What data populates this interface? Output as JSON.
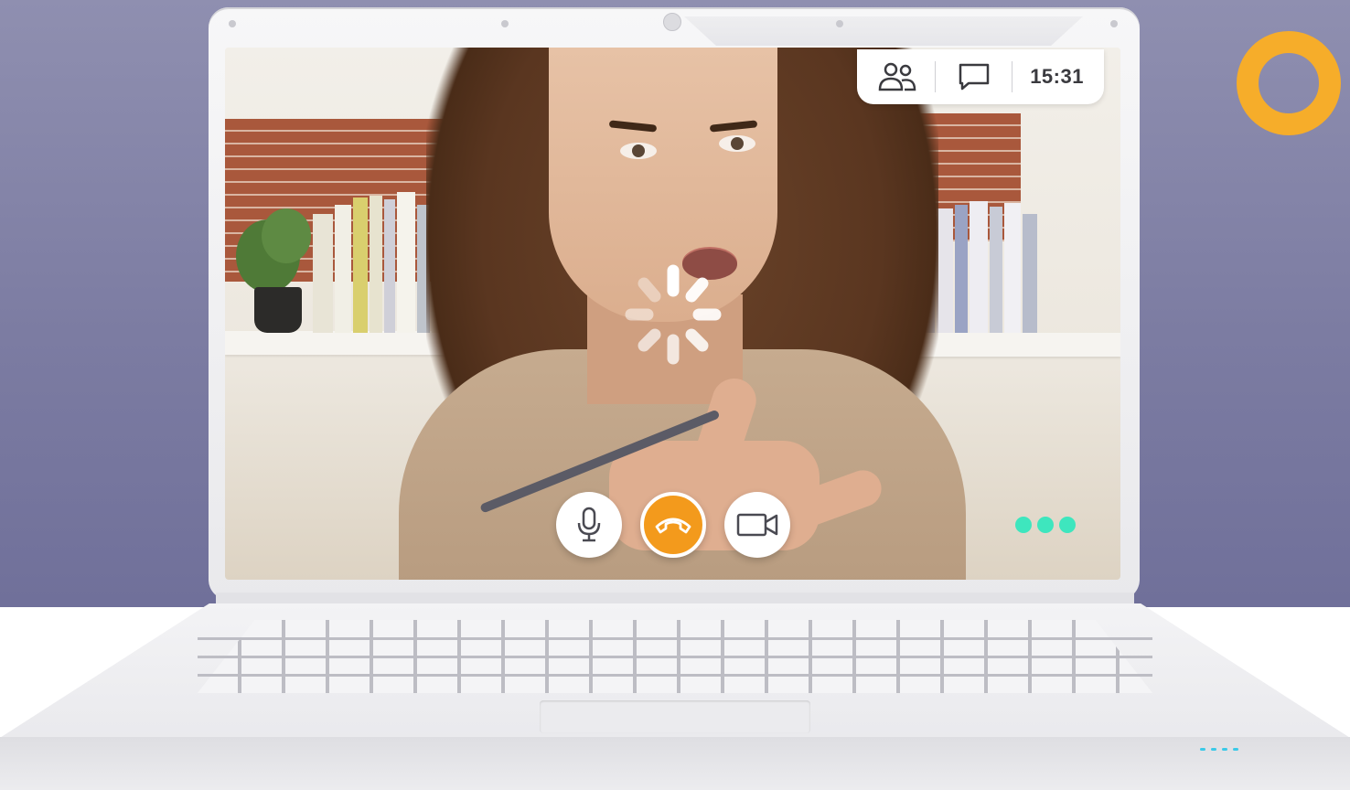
{
  "call": {
    "time": "15:31",
    "participants_icon": "participants-icon",
    "chat_icon": "chat-icon",
    "spinner_icon": "loading-spinner-icon"
  },
  "controls": {
    "mic_icon": "microphone-icon",
    "hangup_icon": "hang-up-icon",
    "video_icon": "video-camera-icon",
    "typing_icon": "typing-indicator-icon"
  },
  "colors": {
    "accent": "#f39a1c",
    "ring": "#f6ad2a",
    "typing": "#3ee6be",
    "background": "#7c7ca2"
  }
}
